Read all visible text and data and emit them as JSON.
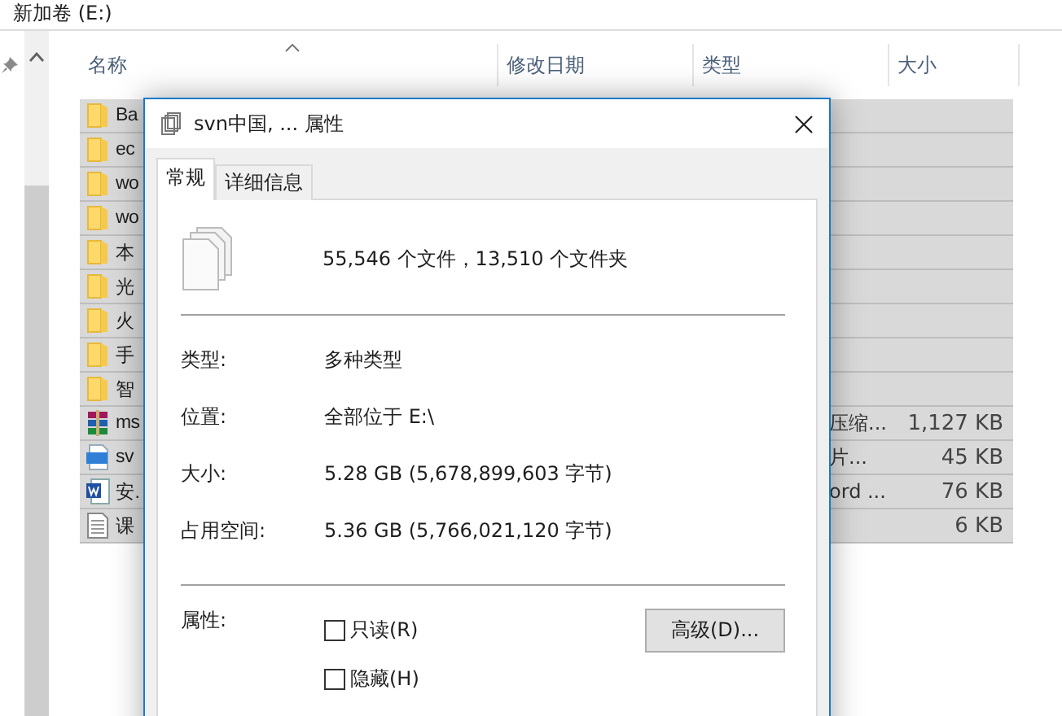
{
  "location": "新加卷 (E:)",
  "columns": [
    "名称",
    "修改日期",
    "类型",
    "大小"
  ],
  "files": [
    {
      "name": "Ba",
      "kind": "folder"
    },
    {
      "name": "ec",
      "kind": "folder"
    },
    {
      "name": "wo",
      "kind": "folder"
    },
    {
      "name": "wo",
      "kind": "folder"
    },
    {
      "name": "本",
      "kind": "folder"
    },
    {
      "name": "光",
      "kind": "folder"
    },
    {
      "name": "火",
      "kind": "folder"
    },
    {
      "name": "手",
      "kind": "folder"
    },
    {
      "name": "智",
      "kind": "folder"
    },
    {
      "name": "ms",
      "kind": "archive",
      "type": "压缩...",
      "size": "1,127 KB"
    },
    {
      "name": "sv",
      "kind": "image",
      "type": "片...",
      "size": "45 KB"
    },
    {
      "name": "安.",
      "kind": "word",
      "type": "ord ...",
      "size": "76 KB"
    },
    {
      "name": "课",
      "kind": "text",
      "size": "6 KB"
    }
  ],
  "dialog": {
    "title": "svn中国, ... 属性",
    "tabs": [
      {
        "label": "常规",
        "selected": true
      },
      {
        "label": "详细信息",
        "selected": false
      }
    ],
    "summary": "55,546 个文件，13,510 个文件夹",
    "fields": [
      {
        "label": "类型:",
        "value": "多种类型"
      },
      {
        "label": "位置:",
        "value": "全部位于 E:\\"
      },
      {
        "label": "大小:",
        "value": "5.28 GB (5,678,899,603 字节)"
      },
      {
        "label": "占用空间:",
        "value": "5.36 GB (5,766,021,120 字节)"
      }
    ],
    "attributes_label": "属性:",
    "attributes": [
      {
        "label": "只读(R)",
        "checked": false
      },
      {
        "label": "隐藏(H)",
        "checked": false
      }
    ],
    "advanced_button": "高级(D)..."
  }
}
